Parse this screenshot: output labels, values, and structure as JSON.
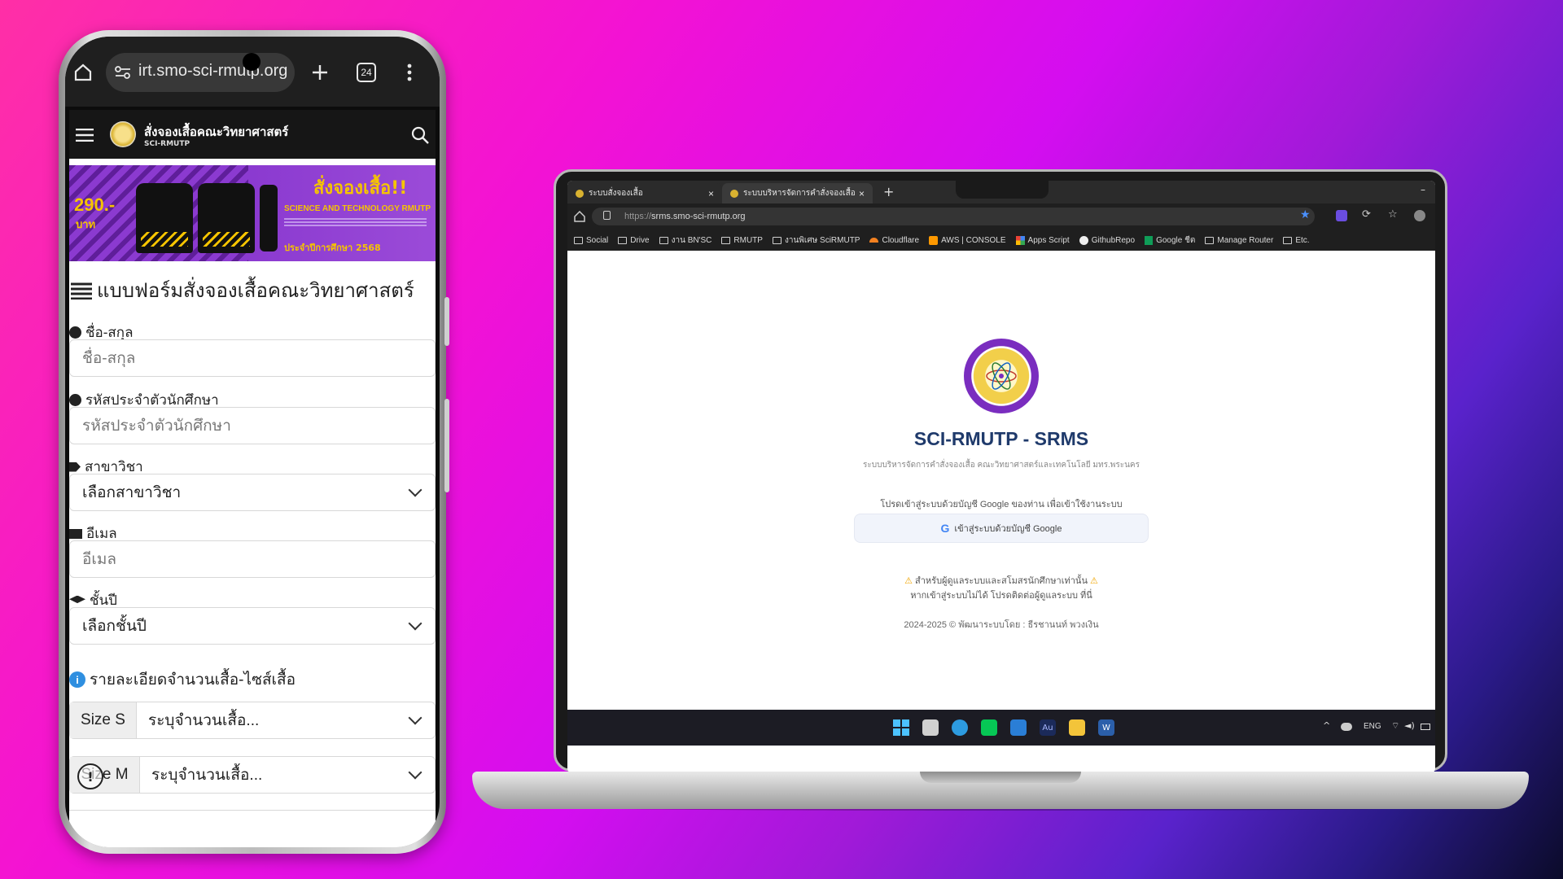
{
  "phone": {
    "url": "irt.smo-sci-rmutp.org",
    "tab_count": "24",
    "site_title": "สั่งจองเสื้อคณะวิทยาศาสตร์",
    "site_subtitle": "SCI-RMUTP",
    "banner": {
      "price": "290.-",
      "price_unit": "บาท",
      "headline": "สั่งจองเสื้อ!!",
      "line1": "SCIENCE AND TECHNOLOGY RMUTP",
      "line2": "ประจำปีการศึกษา 2568"
    },
    "form_title": "แบบฟอร์มสั่งจองเสื้อคณะวิทยาศาสตร์",
    "fields": {
      "name_label": "ชื่อ-สกุล",
      "name_placeholder": "ชื่อ-สกุล",
      "student_id_label": "รหัสประจำตัวนักศึกษา",
      "student_id_placeholder": "รหัสประจำตัวนักศึกษา",
      "major_label": "สาขาวิชา",
      "major_value": "เลือกสาขาวิชา",
      "email_label": "อีเมล",
      "email_placeholder": "อีเมล",
      "year_label": "ชั้นปี",
      "year_value": "เลือกชั้นปี"
    },
    "size_section_title": "รายละเอียดจำนวนเสื้อ-ไซส์เสื้อ",
    "sizes": [
      {
        "label": "Size S",
        "value": "ระบุจำนวนเสื้อ..."
      },
      {
        "label": "Size M",
        "value": "ระบุจำนวนเสื้อ..."
      }
    ]
  },
  "laptop": {
    "tabs": [
      {
        "title": "ระบบสั่งจองเสื้อ"
      },
      {
        "title": "ระบบบริหารจัดการคำสั่งจองเสื้อ คณะวิท"
      }
    ],
    "url_prefix": "https://",
    "url_host": "srms.smo-sci-rmutp.org",
    "bookmarks": [
      "Social",
      "Drive",
      "งาน BN'SC",
      "RMUTP",
      "งานพิเศษ SciRMUTP",
      "Cloudflare",
      "AWS | CONSOLE",
      "Apps Script",
      "GithubRepo",
      "Google ชีต",
      "Manage Router",
      "Etc."
    ],
    "page": {
      "title": "SCI-RMUTP - SRMS",
      "subtitle": "ระบบบริหารจัดการคำสั่งจองเสื้อ คณะวิทยาศาสตร์และเทคโนโลยี มทร.พระนคร",
      "prompt": "โปรดเข้าสู่ระบบด้วยบัญชี Google ของท่าน เพื่อเข้าใช้งานระบบ",
      "login_button": "เข้าสู่ระบบด้วยบัญชี Google",
      "warning1": "สำหรับผู้ดูแลระบบและสโมสรนักศึกษาเท่านั้น",
      "warning2": "หากเข้าสู่ระบบไม่ได้ โปรดติดต่อผู้ดูแลระบบ ที่นี่",
      "footer": "2024-2025 © พัฒนาระบบโดย : ธีรชานนท์ พวงเงิน"
    },
    "taskbar": {
      "lang": "ENG"
    }
  },
  "colors": {
    "accent_blue": "#1f3a6b",
    "purple": "#7a2dbf",
    "banner_yellow": "#f5c400"
  }
}
